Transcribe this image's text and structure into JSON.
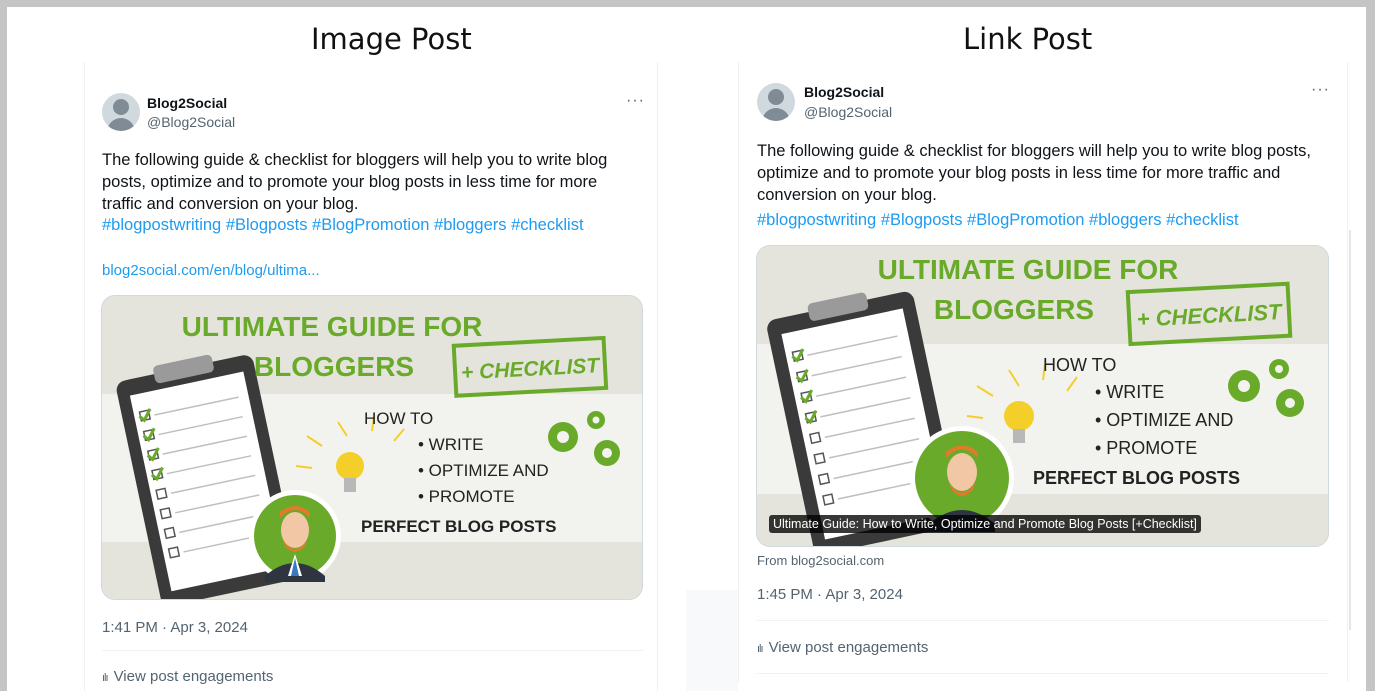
{
  "headings": {
    "left": "Image Post",
    "right": "Link Post"
  },
  "image_post": {
    "author_name": "Blog2Social",
    "author_handle": "@Blog2Social",
    "more_icon": "more-horizontal-icon",
    "text": "The following guide & checklist for bloggers will help you to write blog posts, optimize and to promote your blog posts in less time for more traffic and conversion on your blog.",
    "hashtags": "#blogpostwriting #Blogposts #BlogPromotion #bloggers #checklist",
    "link": "blog2social.com/en/blog/ultima...",
    "timestamp": "1:41 PM · Apr 3, 2024",
    "engagements": "View post engagements"
  },
  "link_post": {
    "author_name": "Blog2Social",
    "author_handle": "@Blog2Social",
    "more_icon": "more-horizontal-icon",
    "text": "The following guide & checklist for bloggers will help you to write blog posts, optimize and to promote your blog posts in less time for more traffic and conversion on your blog.",
    "hashtags": "#blogpostwriting #Blogposts #BlogPromotion #bloggers #checklist",
    "card_caption": "Ultimate Guide: How to Write, Optimize and Promote Blog Posts [+Checklist]",
    "card_source": "From blog2social.com",
    "timestamp": "1:45 PM · Apr 3, 2024",
    "engagements": "View post engagements"
  },
  "graphic": {
    "title_line1": "ULTIMATE GUIDE FOR",
    "title_line2": "BLOGGERS",
    "stamp": "+ CHECKLIST",
    "how_to": "HOW TO",
    "bullets": [
      "• WRITE",
      "• OPTIMIZE AND",
      "• PROMOTE"
    ],
    "footer": "PERFECT BLOG POSTS"
  },
  "colors": {
    "accent_green": "#6aaa2a",
    "link_blue": "#1d9bf0",
    "text_dark": "#0f1419",
    "text_muted": "#536471",
    "frame_grey": "#c5c5c5"
  }
}
